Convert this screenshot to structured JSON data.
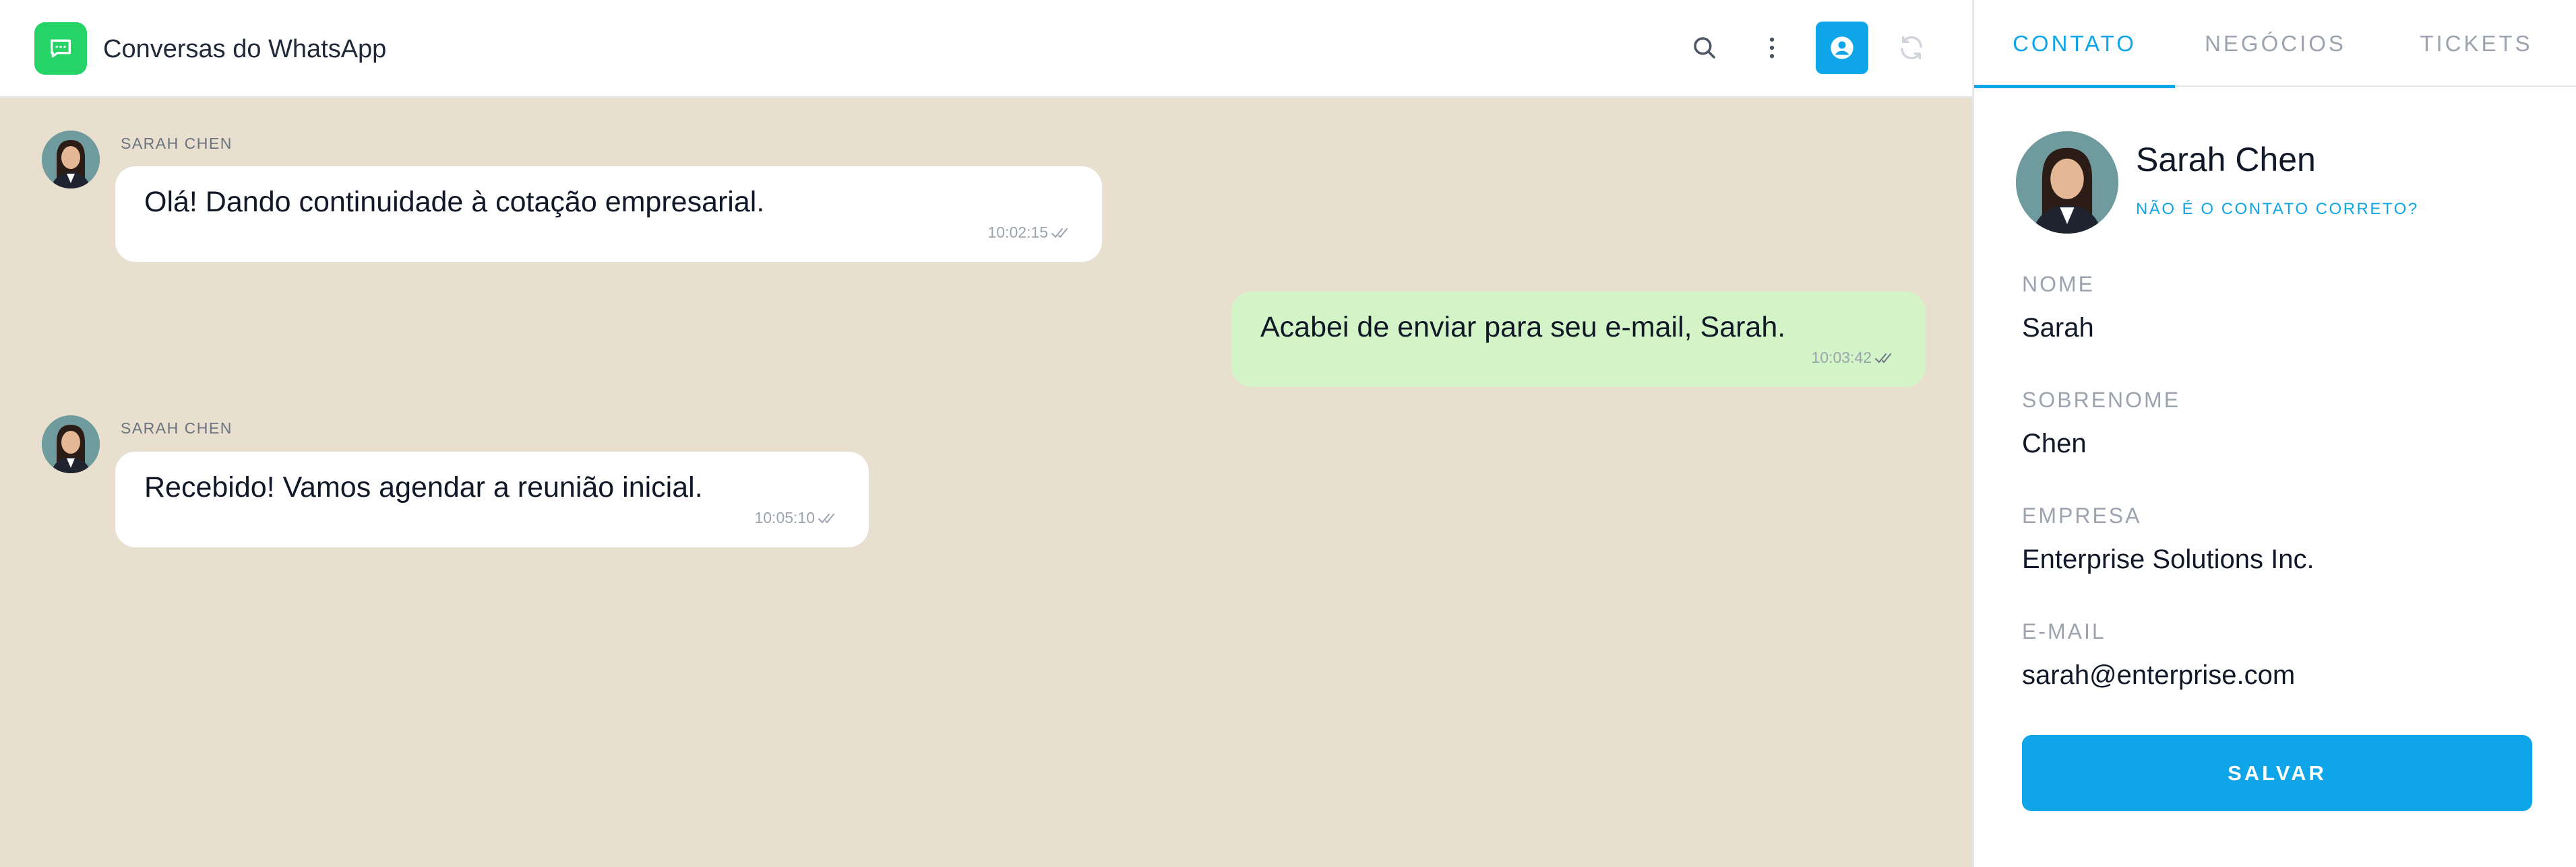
{
  "header": {
    "title": "Conversas do WhatsApp",
    "app_icon": "chat-bubble-icon",
    "actions": {
      "search_icon": "search-icon",
      "more_icon": "more-vertical-icon",
      "contact_icon": "user-circle-icon",
      "refresh_icon": "refresh-icon"
    }
  },
  "messages": [
    {
      "direction": "incoming",
      "sender": "SARAH CHEN",
      "text": "Olá! Dando continuidade à cotação empresarial.",
      "time": "10:02:15",
      "status_icon": "double-check-icon"
    },
    {
      "direction": "outgoing",
      "sender": "",
      "text": "Acabei de enviar para seu e-mail, Sarah.",
      "time": "10:03:42",
      "status_icon": "double-check-icon"
    },
    {
      "direction": "incoming",
      "sender": "SARAH CHEN",
      "text": "Recebido! Vamos agendar a reunião inicial.",
      "time": "10:05:10",
      "status_icon": "double-check-icon"
    }
  ],
  "side_panel": {
    "tabs": [
      {
        "label": "CONTATO",
        "active": true
      },
      {
        "label": "NEGÓCIOS",
        "active": false
      },
      {
        "label": "TICKETS",
        "active": false
      }
    ],
    "contact": {
      "name": "Sarah Chen",
      "wrong_contact_link": "NÃO É O CONTATO CORRETO?"
    },
    "fields": [
      {
        "label": "NOME",
        "value": "Sarah"
      },
      {
        "label": "SOBRENOME",
        "value": "Chen"
      },
      {
        "label": "EMPRESA",
        "value": "Enterprise Solutions Inc."
      },
      {
        "label": "E-MAIL",
        "value": "sarah@enterprise.com"
      }
    ],
    "save_label": "SALVAR"
  },
  "colors": {
    "chat_background": "#e8dfcf",
    "incoming_bubble": "#ffffff",
    "outgoing_bubble": "#d3f4c6",
    "accent": "#0ea5e9",
    "whatsapp_green": "#25d366"
  }
}
